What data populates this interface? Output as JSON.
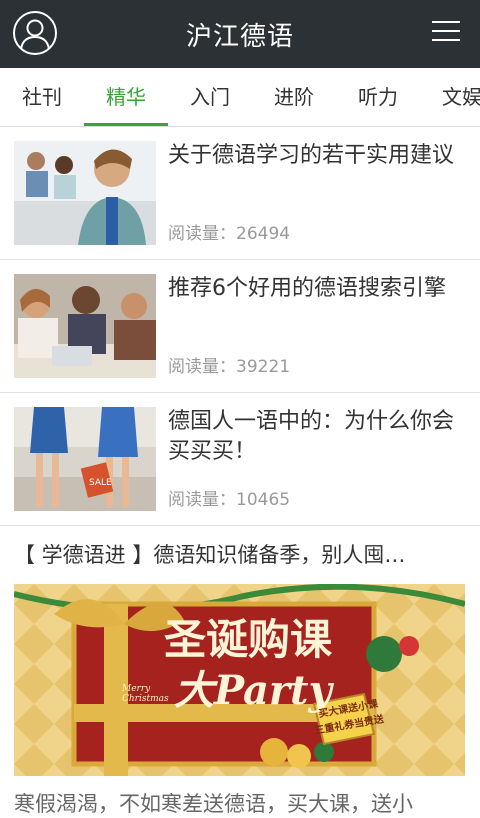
{
  "app": {
    "title": "沪江德语"
  },
  "tabs": [
    {
      "label": "社刊"
    },
    {
      "label": "精华",
      "active": true
    },
    {
      "label": "入门"
    },
    {
      "label": "进阶"
    },
    {
      "label": "听力"
    },
    {
      "label": "文娱"
    }
  ],
  "articles": [
    {
      "title": "关于德语学习的若干实用建议",
      "reads_label": "阅读量：",
      "reads": "26494",
      "thumb_icon": "classroom-photo"
    },
    {
      "title": "推荐6个好用的德语搜索引擎",
      "reads_label": "阅读量：",
      "reads": "39221",
      "thumb_icon": "students-laptop-photo"
    },
    {
      "title": "德国人一语中的：为什么你会买买买！",
      "reads_label": "阅读量：",
      "reads": "10465",
      "thumb_icon": "shopping-legs-photo"
    }
  ],
  "promo": {
    "title": "【 学德语进 】德语知识储备季，别人囤…",
    "banner": {
      "line1": "圣诞购课",
      "line2": "大Party",
      "ribbon": "Merry Christmas",
      "badge1": "买大课送小课",
      "badge2": "三重礼券当贵送"
    },
    "next_text": "寒假渴渴，不如寒差送德语，买大课，送小"
  },
  "colors": {
    "topbar": "#2c3136",
    "accent": "#3aa43a"
  }
}
